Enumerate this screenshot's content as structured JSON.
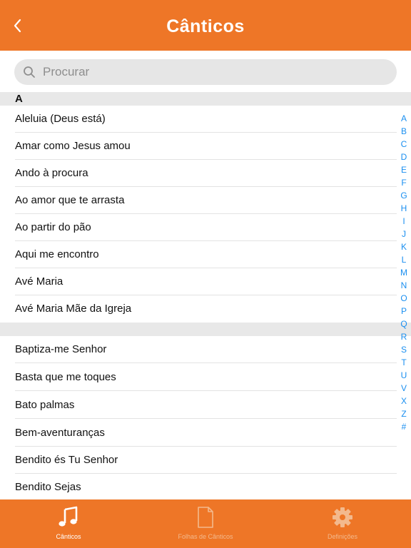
{
  "header": {
    "title": "Cânticos",
    "back_icon": "chevron-left-icon"
  },
  "search": {
    "placeholder": "Procurar",
    "value": ""
  },
  "sections": [
    {
      "letter": "A",
      "items": [
        "Aleluia (Deus está)",
        "Amar como Jesus amou",
        "Ando à procura",
        "Ao amor que te arrasta",
        "Ao partir do pão",
        "Aqui me encontro",
        "Avé Maria",
        "Avé Maria Mãe da Igreja"
      ]
    },
    {
      "letter": "",
      "items": [
        "Baptiza-me Senhor",
        "Basta que me toques",
        "Bato palmas",
        "Bem-aventuranças",
        "Bendito és Tu Senhor",
        "Bendito Sejas"
      ]
    }
  ],
  "index_letters": [
    "A",
    "B",
    "C",
    "D",
    "E",
    "F",
    "G",
    "H",
    "I",
    "J",
    "K",
    "L",
    "M",
    "N",
    "O",
    "P",
    "Q",
    "R",
    "S",
    "T",
    "U",
    "V",
    "X",
    "Z",
    "#"
  ],
  "tabs": [
    {
      "label": "Cânticos",
      "icon": "music-note-icon",
      "active": true
    },
    {
      "label": "Folhas de Cânticos",
      "icon": "document-icon",
      "active": false
    },
    {
      "label": "Definições",
      "icon": "gear-icon",
      "active": false
    }
  ],
  "colors": {
    "accent": "#ee7627",
    "index": "#1a8ff0",
    "tab_inactive": "#f3b98d"
  }
}
